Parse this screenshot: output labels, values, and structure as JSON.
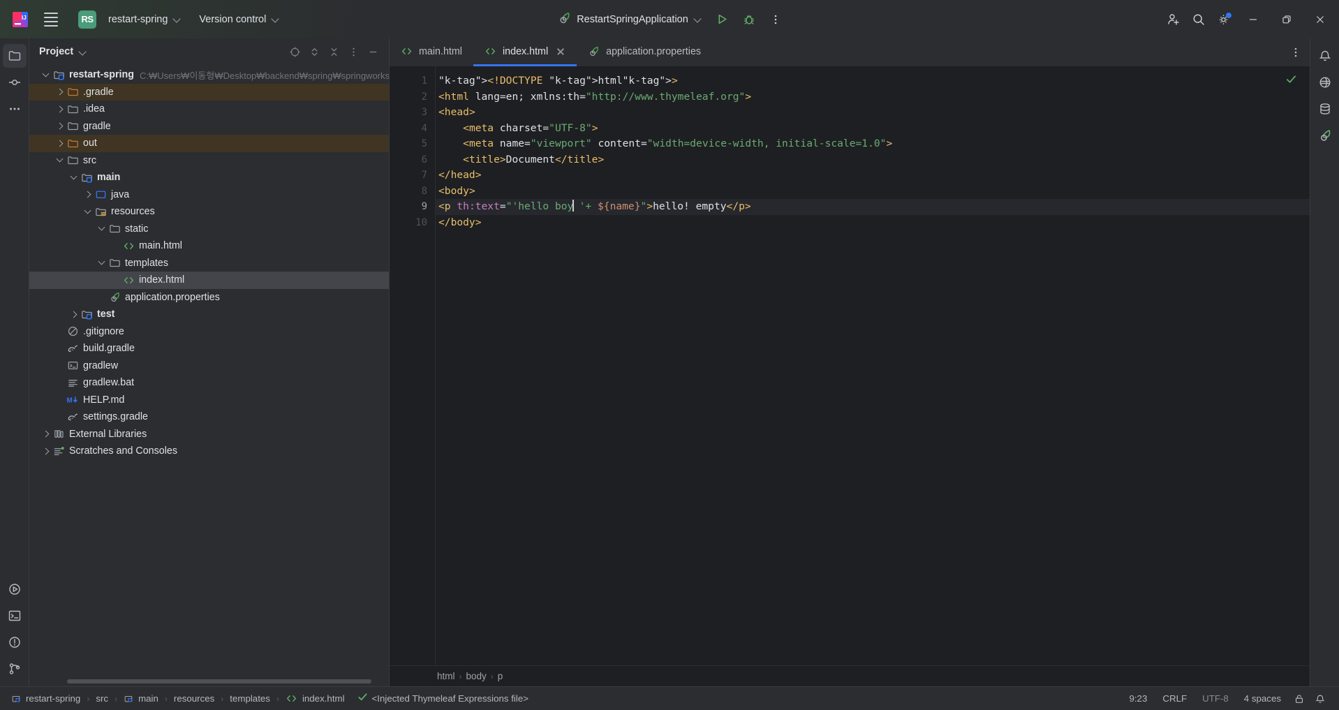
{
  "titlebar": {
    "logo_icon": "intellij-idea-logo",
    "menu_icon": "hamburger-menu-icon",
    "project_badge": "RS",
    "project_name": "restart-spring",
    "vcs_label": "Version control",
    "run_config": "RestartSpringApplication",
    "run_icon": "run-icon",
    "debug_icon": "debug-icon",
    "more_icon": "more-vertical-icon",
    "add_user_icon": "add-user-icon",
    "search_icon": "search-icon",
    "settings_icon": "gear-icon",
    "settings_badge_color": "#3574f0",
    "minimize_icon": "minimize-icon",
    "maximize_icon": "restore-icon",
    "close_icon": "close-icon"
  },
  "left_strip": [
    {
      "name": "project-tool-window",
      "icon": "folder-icon",
      "active": true
    },
    {
      "name": "commit-tool-window",
      "icon": "commit-icon",
      "active": false
    },
    {
      "name": "more-tool-windows",
      "icon": "more-horizontal-icon",
      "active": false
    },
    {
      "name": "run-tool-window",
      "icon": "run-circle-icon",
      "active": false
    },
    {
      "name": "terminal-tool-window",
      "icon": "terminal-icon",
      "active": false
    },
    {
      "name": "problems-tool-window",
      "icon": "problems-icon",
      "active": false
    },
    {
      "name": "git-tool-window",
      "icon": "git-branch-icon",
      "active": false
    }
  ],
  "right_strip": [
    {
      "name": "notifications-tool-window",
      "icon": "bell-icon"
    },
    {
      "name": "ai-assistant-tool-window",
      "icon": "ai-icon"
    },
    {
      "name": "database-tool-window",
      "icon": "database-icon"
    },
    {
      "name": "spring-tool-window",
      "icon": "spring-leaf-icon"
    }
  ],
  "project_panel": {
    "title": "Project",
    "title_chevron": "chevron-down-icon",
    "actions": [
      {
        "name": "select-opened-file-button",
        "icon": "target-icon"
      },
      {
        "name": "expand-collapse-button",
        "icon": "expand-collapse-icon"
      },
      {
        "name": "collapse-all-button",
        "icon": "collapse-all-icon"
      },
      {
        "name": "panel-options-button",
        "icon": "more-vertical-icon"
      },
      {
        "name": "hide-panel-button",
        "icon": "minimize-icon"
      }
    ],
    "tree": [
      {
        "label": "restart-spring",
        "path": "C:₩Users₩이동형₩Desktop₩backend₩spring₩springworkspace₩res",
        "indent": 0,
        "twisty": "open",
        "icon": "module-folder-icon",
        "bold": true,
        "state": ""
      },
      {
        "label": ".gradle",
        "indent": 1,
        "twisty": "closed",
        "icon": "folder-excluded-icon",
        "bold": false,
        "state": "excluded"
      },
      {
        "label": ".idea",
        "indent": 1,
        "twisty": "closed",
        "icon": "folder-icon",
        "bold": false,
        "state": ""
      },
      {
        "label": "gradle",
        "indent": 1,
        "twisty": "closed",
        "icon": "folder-icon",
        "bold": false,
        "state": ""
      },
      {
        "label": "out",
        "indent": 1,
        "twisty": "closed",
        "icon": "folder-excluded-icon",
        "bold": false,
        "state": "excluded"
      },
      {
        "label": "src",
        "indent": 1,
        "twisty": "open",
        "icon": "folder-icon",
        "bold": false,
        "state": ""
      },
      {
        "label": "main",
        "indent": 2,
        "twisty": "open",
        "icon": "module-folder-icon",
        "bold": true,
        "state": ""
      },
      {
        "label": "java",
        "indent": 3,
        "twisty": "closed",
        "icon": "source-folder-icon",
        "bold": false,
        "state": ""
      },
      {
        "label": "resources",
        "indent": 3,
        "twisty": "open",
        "icon": "resource-folder-icon",
        "bold": false,
        "state": ""
      },
      {
        "label": "static",
        "indent": 4,
        "twisty": "open",
        "icon": "folder-icon",
        "bold": false,
        "state": ""
      },
      {
        "label": "main.html",
        "indent": 5,
        "twisty": "none",
        "icon": "html-file-icon",
        "bold": false,
        "state": ""
      },
      {
        "label": "templates",
        "indent": 4,
        "twisty": "open",
        "icon": "folder-icon",
        "bold": false,
        "state": ""
      },
      {
        "label": "index.html",
        "indent": 5,
        "twisty": "none",
        "icon": "html-file-icon",
        "bold": false,
        "state": "selected"
      },
      {
        "label": "application.properties",
        "indent": 4,
        "twisty": "none",
        "icon": "spring-leaf-icon",
        "bold": false,
        "state": ""
      },
      {
        "label": "test",
        "indent": 2,
        "twisty": "closed",
        "icon": "module-folder-icon",
        "bold": true,
        "state": ""
      },
      {
        "label": ".gitignore",
        "indent": 1,
        "twisty": "none",
        "icon": "gitignore-icon",
        "bold": false,
        "state": ""
      },
      {
        "label": "build.gradle",
        "indent": 1,
        "twisty": "none",
        "icon": "gradle-icon",
        "bold": false,
        "state": ""
      },
      {
        "label": "gradlew",
        "indent": 1,
        "twisty": "none",
        "icon": "shell-script-icon",
        "bold": false,
        "state": ""
      },
      {
        "label": "gradlew.bat",
        "indent": 1,
        "twisty": "none",
        "icon": "text-file-icon",
        "bold": false,
        "state": ""
      },
      {
        "label": "HELP.md",
        "indent": 1,
        "twisty": "none",
        "icon": "markdown-icon",
        "bold": false,
        "state": ""
      },
      {
        "label": "settings.gradle",
        "indent": 1,
        "twisty": "none",
        "icon": "gradle-icon",
        "bold": false,
        "state": ""
      },
      {
        "label": "External Libraries",
        "indent": 0,
        "twisty": "closed",
        "icon": "library-icon",
        "bold": false,
        "state": ""
      },
      {
        "label": "Scratches and Consoles",
        "indent": 0,
        "twisty": "closed",
        "icon": "scratches-icon",
        "bold": false,
        "state": ""
      }
    ]
  },
  "editor": {
    "tabs": [
      {
        "label": "main.html",
        "icon": "html-file-icon",
        "active": false,
        "closable": false
      },
      {
        "label": "index.html",
        "icon": "html-file-icon",
        "active": true,
        "closable": true
      },
      {
        "label": "application.properties",
        "icon": "spring-leaf-icon",
        "active": false,
        "closable": false
      }
    ],
    "tab_options_icon": "more-vertical-icon",
    "inspection_status_icon": "checkmark-icon",
    "line_numbers": [
      "1",
      "2",
      "3",
      "4",
      "5",
      "6",
      "7",
      "8",
      "9",
      "10"
    ],
    "current_line": 9,
    "lines": [
      "<!DOCTYPE html>",
      "<html lang=en; xmlns:th=\"http://www.thymeleaf.org\">",
      "<head>",
      "    <meta charset=\"UTF-8\">",
      "    <meta name=\"viewport\" content=\"width=device-width, initial-scale=1.0\">",
      "    <title>Document</title>",
      "</head>",
      "<body>",
      "<p th:text=\"'hello boy '+ ${name}\">hello! empty</p>",
      "</body>"
    ],
    "breadcrumbs": [
      "html",
      "body",
      "p"
    ]
  },
  "statusbar": {
    "crumbs": [
      {
        "label": "restart-spring",
        "icon": "module-icon"
      },
      {
        "label": "src",
        "icon": ""
      },
      {
        "label": "main",
        "icon": "module-icon"
      },
      {
        "label": "resources",
        "icon": ""
      },
      {
        "label": "templates",
        "icon": ""
      },
      {
        "label": "index.html",
        "icon": "html-file-icon"
      }
    ],
    "validation_icon": "green-check-icon",
    "validation_text": "<Injected Thymeleaf Expressions file>",
    "caret_position": "9:23",
    "line_separator": "CRLF",
    "encoding": "UTF-8",
    "indent": "4 spaces",
    "lock_icon": "lock-icon",
    "notification_icon": "bell-icon"
  }
}
